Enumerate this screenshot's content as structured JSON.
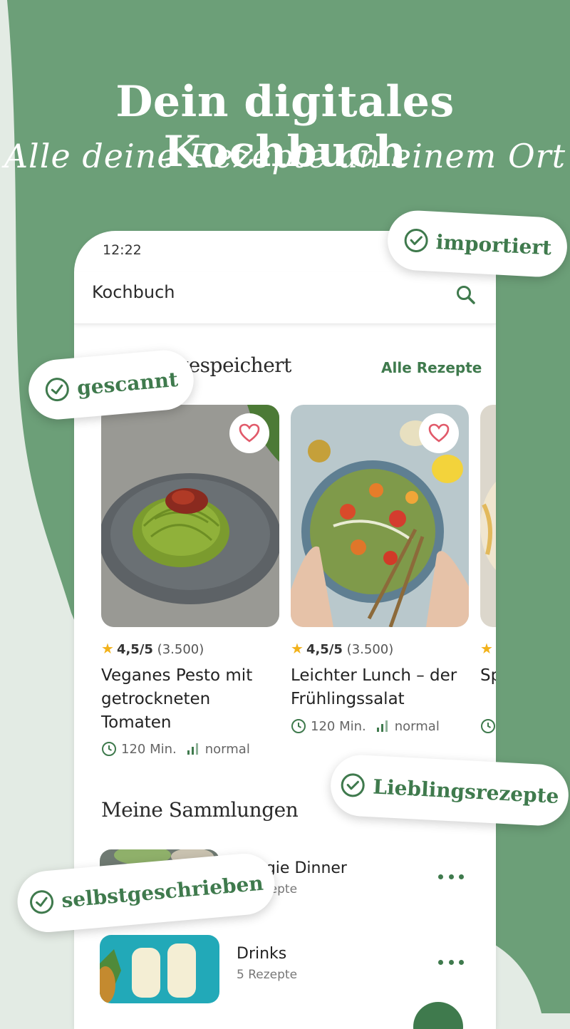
{
  "headline": "Dein digitales Kochbuch",
  "subline": "Alle deine Rezepte an einem Ort",
  "status_time": "12:22",
  "appbar": {
    "title": "Kochbuch"
  },
  "saved_section": {
    "title": "Zuletzt gespeichert",
    "link": "Alle Rezepte"
  },
  "recipes": [
    {
      "rating": "4,5/5",
      "count": "(3.500)",
      "title": "Veganes Pesto mit getrockneten Tomaten",
      "time": "120 Min.",
      "difficulty": "normal"
    },
    {
      "rating": "4,5/5",
      "count": "(3.500)",
      "title": "Leichter Lunch – der Frühlingssalat",
      "time": "120 Min.",
      "difficulty": "normal"
    },
    {
      "title": "Sp"
    }
  ],
  "collections_section": {
    "title": "Meine Sammlungen"
  },
  "collections": [
    {
      "name": "Veggie Dinner",
      "count": "8 Rezepte"
    },
    {
      "name": "Drinks",
      "count": "5 Rezepte"
    }
  ],
  "badges": {
    "importiert": "importiert",
    "gescannt": "gescannt",
    "lieblingsrezepte": "Lieblingsrezepte",
    "selbstgeschrieben": "selbstgeschrieben"
  },
  "colors": {
    "green": "#6c9f78",
    "accent": "#3f7a4d",
    "star": "#f2b21b"
  }
}
